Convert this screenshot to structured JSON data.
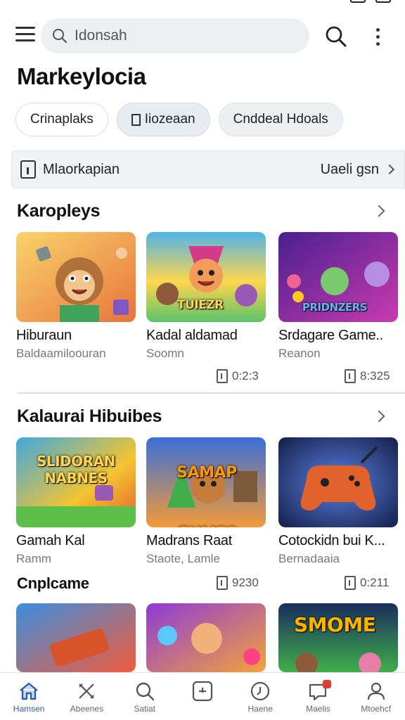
{
  "app": {
    "search": {
      "placeholder": "Idonsah"
    },
    "page_title": "Markeylocia"
  },
  "chips": [
    {
      "label": "Crinaplaks"
    },
    {
      "label": "Iiozeaan"
    },
    {
      "label": "Cnddeal Hdoals"
    }
  ],
  "info_bar": {
    "label": "Mlaorkapian",
    "action": "Uaeli gsn"
  },
  "sections": [
    {
      "title": "Karopleys",
      "cards": [
        {
          "title": "Hiburaun",
          "subtitle": "Baldaamiloouran",
          "art_text": "",
          "colors": [
            "#f7c24a",
            "#e8743b"
          ]
        },
        {
          "title": "Kadal aldamad",
          "subtitle": "Soomn",
          "art_text": "TUIEZR",
          "colors": [
            "#5cc36b",
            "#ffd64d"
          ]
        },
        {
          "title": "Srdagare Game..",
          "subtitle": "Reanon",
          "art_text": "PRIDNZERS",
          "colors": [
            "#6a2fb8",
            "#c93bb0"
          ]
        }
      ],
      "meta": [
        {
          "value": "0:2:3"
        },
        {
          "value": "8:325"
        }
      ]
    },
    {
      "title": "Kalaurai Hibuibes",
      "cards": [
        {
          "title": "Gamah Kal",
          "subtitle": "Ramm",
          "art_text": "SLIDORAN NABNES",
          "colors": [
            "#3ea9e0",
            "#f4c431"
          ]
        },
        {
          "title": "Madrans Raat",
          "subtitle": "Staote, Lamle",
          "art_text": "SAMAP GUMES",
          "colors": [
            "#3b6fd8",
            "#f29b3a"
          ]
        },
        {
          "title": "Cotockidn bui K...",
          "subtitle": "Bernadaaia",
          "art_text": "",
          "colors": [
            "#1d2f6b",
            "#e2622e"
          ]
        }
      ]
    },
    {
      "title": "Cnplcame",
      "meta": [
        {
          "value": "9230"
        },
        {
          "value": "0:211"
        }
      ],
      "cards": [
        {
          "art_text": "",
          "colors": [
            "#3a8fe0",
            "#f25b3b"
          ]
        },
        {
          "art_text": "",
          "colors": [
            "#8e3ad8",
            "#f3a43a"
          ]
        },
        {
          "art_text": "SMOME",
          "colors": [
            "#1b2d5e",
            "#3fae4a"
          ]
        }
      ]
    }
  ],
  "bottom_nav": [
    {
      "label": "Hamsen",
      "icon": "home-icon",
      "active": true
    },
    {
      "label": "Abeenes",
      "icon": "crossed-tools-icon"
    },
    {
      "label": "Satiat",
      "icon": "search-icon"
    },
    {
      "label": "",
      "icon": "add-box-icon"
    },
    {
      "label": "Haene",
      "icon": "heart-icon"
    },
    {
      "label": "Maelis",
      "icon": "inbox-icon",
      "badge": true
    },
    {
      "label": "Mtoehcf",
      "icon": "profile-icon"
    }
  ],
  "colors": {
    "accent": "#2b5fa8",
    "badge": "#e53935",
    "chip_selected": "#e8edf4"
  }
}
